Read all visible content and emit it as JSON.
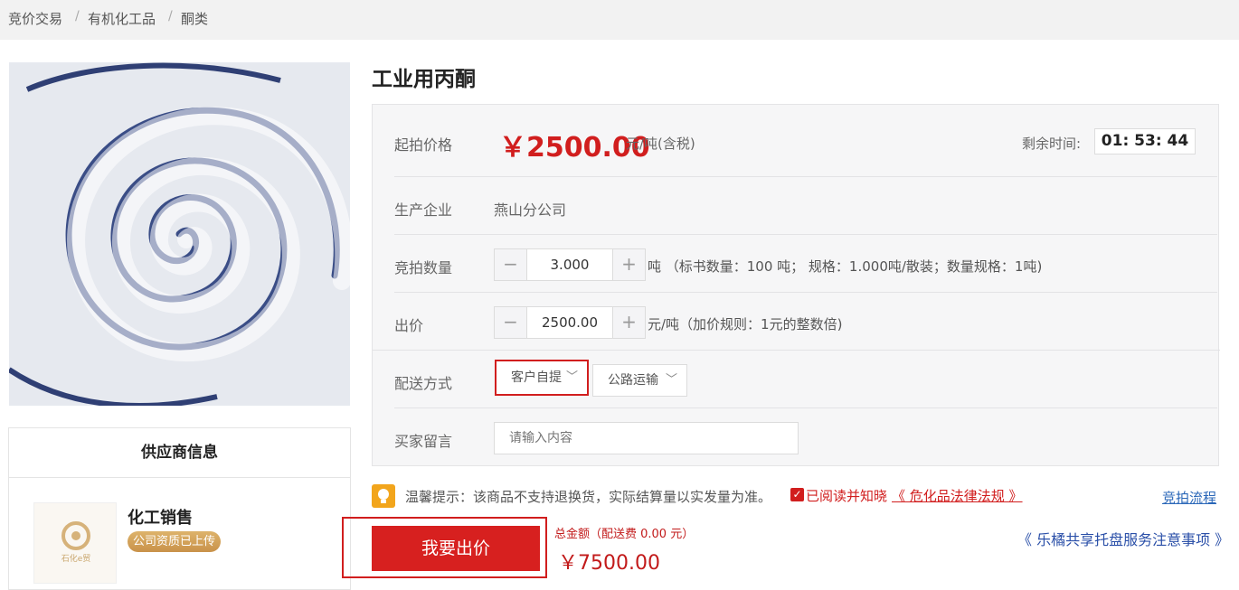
{
  "breadcrumb": {
    "items": [
      "竞价交易",
      "有机化工品",
      "酮类"
    ],
    "separator": "/"
  },
  "product": {
    "title": "工业用丙酮",
    "start_price_label": "起拍价格",
    "price": "￥2500.00",
    "price_unit": "元/吨(含税)",
    "remaining_label": "剩余时间:",
    "remaining_time": "01: 53: 44",
    "company_label": "生产企业",
    "company_value": "燕山分公司",
    "quantity_label": "竞拍数量",
    "quantity_value": "3.000",
    "quantity_note": "吨 （标书数量：100 吨； 规格：1.000吨/散装；数量规格：1吨)",
    "bid_label": "出价",
    "bid_value": "2500.00",
    "bid_note": "元/吨（加价规则：1元的整数倍)",
    "delivery_label": "配送方式",
    "delivery_options": [
      "客户自提",
      "公路运输"
    ],
    "delivery_selected": "客户自提",
    "message_label": "买家留言",
    "message_placeholder": "请输入内容",
    "stepper_minus": "−",
    "stepper_plus": "+"
  },
  "supplier": {
    "header": "供应商信息",
    "name": "化工销售",
    "badge": "公司资质已上传",
    "logo_text": "石化e贸"
  },
  "footer": {
    "tip": "温馨提示：该商品不支持退换货，实际结算量以实发量为准。",
    "read_text": "已阅读并知晓",
    "law_link": "《 危化品法律法规 》",
    "flow_link": "竞拍流程",
    "bid_button": "我要出价",
    "total_label": "总金额（配送费 0.00 元）",
    "total_value": "￥7500.00",
    "notice_link": "《 乐橘共享托盘服务注意事项 》"
  },
  "colors": {
    "accent_red": "#d11e1e",
    "link_blue": "#2a67b8",
    "badge_gold": "#c9924a",
    "tip_orange": "#f2a51c"
  },
  "icons": {
    "tip": "lightbulb-icon",
    "checkbox": "checkbox-checked-icon",
    "dropdown": "chevron-down-icon"
  }
}
